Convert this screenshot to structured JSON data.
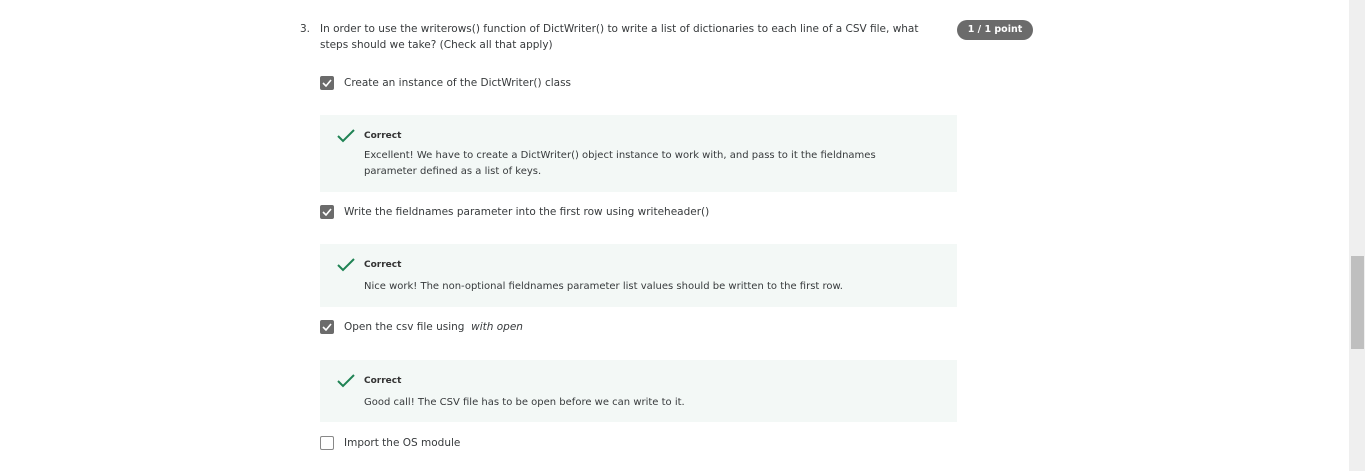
{
  "question": {
    "number": "3.",
    "text": "In order to use the writerows() function of DictWriter() to write a list of dictionaries to each line of a CSV file, what steps should we take? (Check all that apply)",
    "score": "1 / 1 point"
  },
  "options": [
    {
      "label": "Create an instance of the DictWriter() class",
      "checked": true,
      "feedback": {
        "status": "Correct",
        "message": "Excellent! We have to create a DictWriter() object instance to work with, and pass to it the fieldnames parameter defined as a list of keys."
      }
    },
    {
      "label": "Write the fieldnames parameter into the first row using writeheader()",
      "checked": true,
      "feedback": {
        "status": "Correct",
        "message": "Nice work! The non-optional fieldnames parameter list values should be written to the first row."
      }
    },
    {
      "label": "Open the csv file using ",
      "label_em": "with open",
      "checked": true,
      "feedback": {
        "status": "Correct",
        "message": "Good call! The CSV file has to be open before we can write to it."
      }
    },
    {
      "label": "Import the OS module",
      "checked": false
    }
  ],
  "colors": {
    "correct": "#1f8354",
    "feedback_bg": "#f3f8f6",
    "badge": "#6b6b6b"
  }
}
